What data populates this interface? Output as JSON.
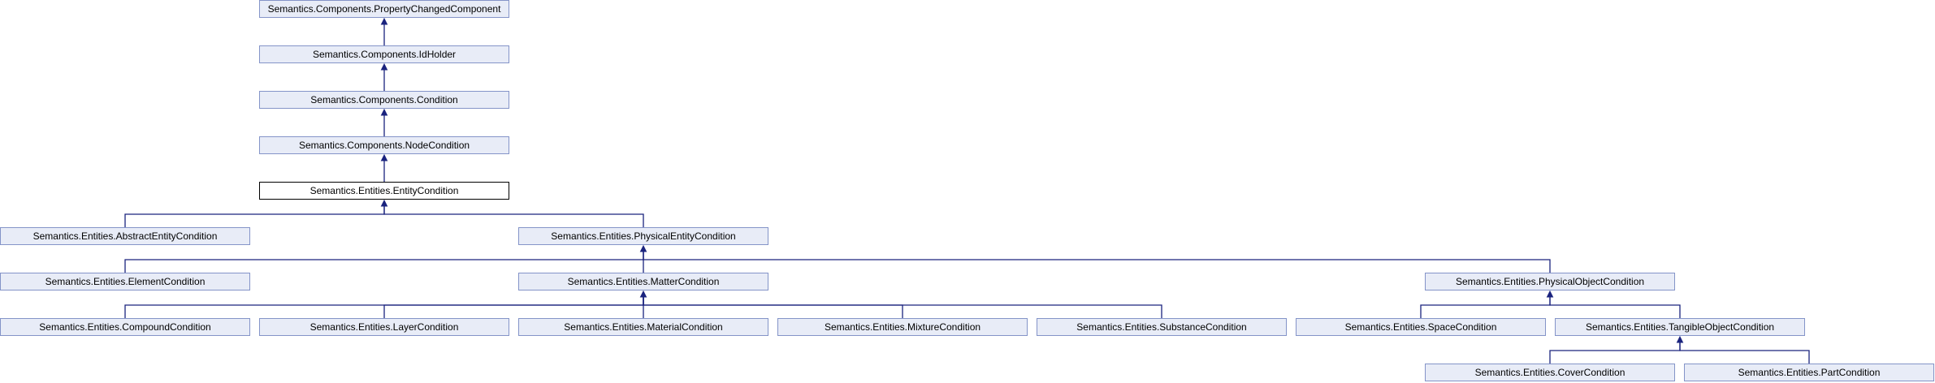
{
  "diagram": {
    "nodes": [
      {
        "id": "property_changed_component",
        "label": "Semantics.Components.PropertyChangedComponent"
      },
      {
        "id": "id_holder",
        "label": "Semantics.Components.IdHolder"
      },
      {
        "id": "condition",
        "label": "Semantics.Components.Condition"
      },
      {
        "id": "node_condition",
        "label": "Semantics.Components.NodeCondition"
      },
      {
        "id": "entity_condition",
        "label": "Semantics.Entities.EntityCondition",
        "current": true
      },
      {
        "id": "abstract_entity_condition",
        "label": "Semantics.Entities.AbstractEntityCondition"
      },
      {
        "id": "physical_entity_condition",
        "label": "Semantics.Entities.PhysicalEntityCondition"
      },
      {
        "id": "element_condition",
        "label": "Semantics.Entities.ElementCondition"
      },
      {
        "id": "matter_condition",
        "label": "Semantics.Entities.MatterCondition"
      },
      {
        "id": "physical_object_condition",
        "label": "Semantics.Entities.PhysicalObjectCondition"
      },
      {
        "id": "compound_condition",
        "label": "Semantics.Entities.CompoundCondition"
      },
      {
        "id": "layer_condition",
        "label": "Semantics.Entities.LayerCondition"
      },
      {
        "id": "material_condition",
        "label": "Semantics.Entities.MaterialCondition"
      },
      {
        "id": "mixture_condition",
        "label": "Semantics.Entities.MixtureCondition"
      },
      {
        "id": "substance_condition",
        "label": "Semantics.Entities.SubstanceCondition"
      },
      {
        "id": "space_condition",
        "label": "Semantics.Entities.SpaceCondition"
      },
      {
        "id": "tangible_object_condition",
        "label": "Semantics.Entities.TangibleObjectCondition"
      },
      {
        "id": "cover_condition",
        "label": "Semantics.Entities.CoverCondition"
      },
      {
        "id": "part_condition",
        "label": "Semantics.Entities.PartCondition"
      }
    ],
    "edges": [
      {
        "from": "id_holder",
        "to": "property_changed_component"
      },
      {
        "from": "condition",
        "to": "id_holder"
      },
      {
        "from": "node_condition",
        "to": "condition"
      },
      {
        "from": "entity_condition",
        "to": "node_condition"
      },
      {
        "from": "abstract_entity_condition",
        "to": "entity_condition"
      },
      {
        "from": "physical_entity_condition",
        "to": "entity_condition"
      },
      {
        "from": "element_condition",
        "to": "physical_entity_condition"
      },
      {
        "from": "matter_condition",
        "to": "physical_entity_condition"
      },
      {
        "from": "physical_object_condition",
        "to": "physical_entity_condition"
      },
      {
        "from": "compound_condition",
        "to": "matter_condition"
      },
      {
        "from": "layer_condition",
        "to": "matter_condition"
      },
      {
        "from": "material_condition",
        "to": "matter_condition"
      },
      {
        "from": "mixture_condition",
        "to": "matter_condition"
      },
      {
        "from": "substance_condition",
        "to": "matter_condition"
      },
      {
        "from": "space_condition",
        "to": "physical_object_condition"
      },
      {
        "from": "tangible_object_condition",
        "to": "physical_object_condition"
      },
      {
        "from": "cover_condition",
        "to": "tangible_object_condition"
      },
      {
        "from": "part_condition",
        "to": "tangible_object_condition"
      }
    ],
    "colors": {
      "edge": "#1a237e",
      "node_fill": "#e8ecf7",
      "node_border": "#8494c8",
      "current_border": "#000000"
    }
  }
}
